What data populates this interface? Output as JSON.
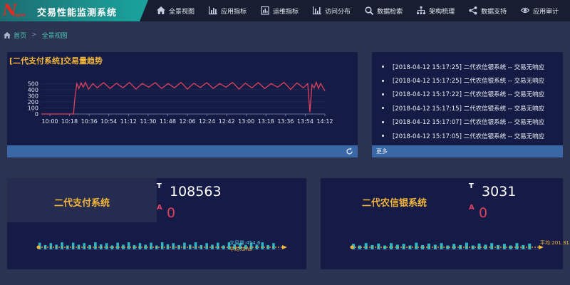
{
  "header": {
    "logo_text": "N",
    "logo_sub": "tapm",
    "title": "交易性能监测系统",
    "nav": [
      {
        "label": "全景视图",
        "icon": "home-icon"
      },
      {
        "label": "应用指标",
        "icon": "bar-chart-icon"
      },
      {
        "label": "运维指标",
        "icon": "report-icon"
      },
      {
        "label": "访问分布",
        "icon": "column-chart-icon"
      },
      {
        "label": "数据检索",
        "icon": "search-icon"
      },
      {
        "label": "架构梳理",
        "icon": "sitemap-icon"
      },
      {
        "label": "数据支持",
        "icon": "share-icon"
      },
      {
        "label": "应用审计",
        "icon": "eye-icon"
      }
    ]
  },
  "breadcrumb": {
    "home_icon": "home-icon",
    "home": "首页",
    "separator": ">",
    "current": "全景视图"
  },
  "trend_panel": {
    "title": "[二代支付系统]交易量趋势",
    "footer_icon": "refresh-icon"
  },
  "chart_data": {
    "type": "line",
    "title": "[二代支付系统]交易量趋势",
    "x_ticks": [
      "10:00",
      "10:18",
      "10:36",
      "10:54",
      "11:12",
      "11:30",
      "11:48",
      "12:06",
      "12:24",
      "12:42",
      "13:00",
      "13:18",
      "13:36",
      "13:54",
      "14:12"
    ],
    "y_ticks": [
      0,
      100,
      200,
      300,
      400,
      500
    ],
    "ylim": [
      0,
      550
    ],
    "x_minutes_range": [
      0,
      264
    ],
    "series": [
      {
        "color": "#e0415e",
        "x": [
          0,
          20,
          26,
          30,
          31,
          33,
          35,
          37,
          39,
          41,
          44,
          48,
          52,
          58,
          64,
          70,
          76,
          82,
          88,
          94,
          100,
          106,
          112,
          118,
          124,
          130,
          136,
          142,
          148,
          154,
          160,
          166,
          172,
          178,
          184,
          190,
          196,
          202,
          208,
          214,
          220,
          226,
          232,
          238,
          244,
          248,
          250,
          252,
          254,
          256,
          258,
          260,
          262,
          264
        ],
        "y": [
          0,
          0,
          0,
          0,
          220,
          500,
          420,
          510,
          440,
          520,
          410,
          500,
          430,
          515,
          420,
          505,
          430,
          520,
          410,
          500,
          440,
          515,
          420,
          500,
          430,
          520,
          410,
          505,
          435,
          515,
          420,
          500,
          440,
          520,
          410,
          505,
          430,
          515,
          420,
          500,
          440,
          520,
          405,
          510,
          430,
          500,
          30,
          480,
          430,
          520,
          420,
          500,
          440,
          380
        ]
      }
    ]
  },
  "log_panel": {
    "items": [
      "[2018-04-12 15:17:25] 二代农信银系统 -- 交易无响应",
      "[2018-04-12 15:17:25] 二代农信银系统 -- 交易无响应",
      "[2018-04-12 15:17:22] 二代农信银系统 -- 交易无响应",
      "[2018-04-12 15:17:15] 二代农信银系统 -- 交易无响应",
      "[2018-04-12 15:17:07] 二代农信银系统 -- 交易无响应",
      "[2018-04-12 15:17:05] 二代农信银系统 -- 交易无响应"
    ],
    "more": "更多"
  },
  "systems": [
    {
      "name": "二代支付系统",
      "t_label": "T",
      "t_value": "108563",
      "a_label": "A",
      "a_value": "0",
      "spark_label_1": "交易量:454.6",
      "spark_label_2": "平均:0ms",
      "bars": [
        0.85,
        0.55,
        0.8,
        0.6,
        0.9,
        0.5,
        0.85,
        0.6,
        0.8,
        0.55,
        0.9,
        0.65,
        0.8,
        0.5,
        0.85,
        0.6,
        0.9,
        0.55,
        0.8,
        0.6,
        0.85,
        0.5,
        0.9,
        0.65,
        0.8,
        0.55,
        0.85,
        0.6,
        0.9,
        0.55,
        0.8,
        0.6,
        0.85,
        0.5,
        0.9,
        0.65,
        0.8,
        0.55,
        0.85,
        0.6,
        0.9,
        0.55,
        0.8
      ],
      "bar_color": "#2fb6c4",
      "line_color": "#f2b53a"
    },
    {
      "name": "二代农信银系统",
      "t_label": "T",
      "t_value": "3031",
      "a_label": "A",
      "a_value": "0",
      "spark_label_1": "平均:201.31",
      "spark_label_2": "",
      "bars": [
        0.7,
        0.5,
        0.8,
        0.55,
        0.75,
        0.5,
        0.8,
        0.6,
        0.7,
        0.5,
        0.85,
        0.55,
        0.75,
        0.6,
        0.8,
        0.5,
        0.7,
        0.55,
        0.85,
        0.5,
        0.75,
        0.6,
        0.8,
        0.55,
        0.7,
        0.5,
        0.8,
        0.55,
        0.75
      ],
      "bar_color": "#2fb6c4",
      "line_color": "#f2b53a"
    }
  ]
}
